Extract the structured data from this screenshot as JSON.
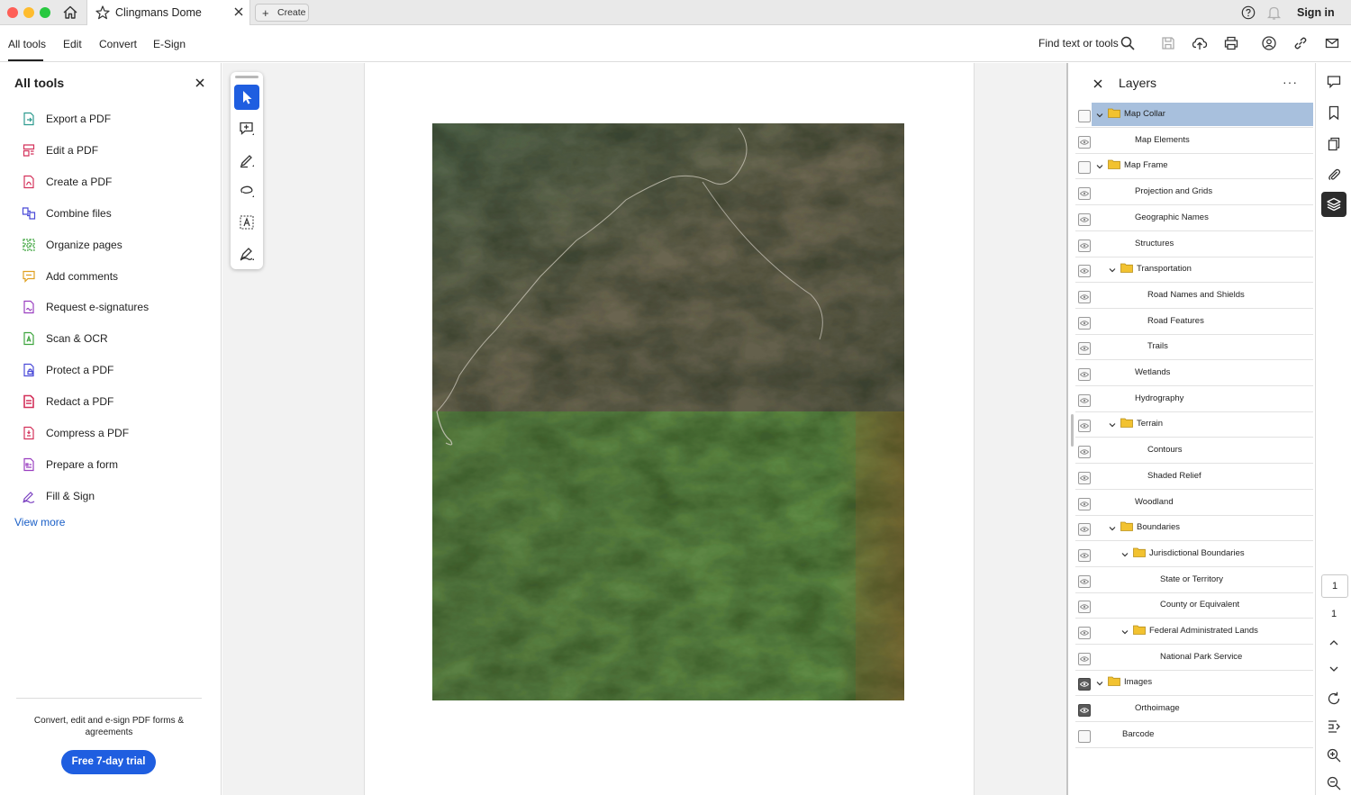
{
  "titlebar": {
    "tab_title": "Clingmans Dome",
    "create_label": "Create",
    "signin_label": "Sign in"
  },
  "menubar": {
    "items": [
      "All tools",
      "Edit",
      "Convert",
      "E-Sign"
    ],
    "find_label": "Find text or tools"
  },
  "all_tools": {
    "title": "All tools",
    "items": [
      {
        "label": "Export a PDF",
        "icon": "export-pdf-icon",
        "color": "#2e9b8f"
      },
      {
        "label": "Edit a PDF",
        "icon": "edit-pdf-icon",
        "color": "#d4325b"
      },
      {
        "label": "Create a PDF",
        "icon": "create-pdf-icon",
        "color": "#d4325b"
      },
      {
        "label": "Combine files",
        "icon": "combine-files-icon",
        "color": "#4a4ad8"
      },
      {
        "label": "Organize pages",
        "icon": "organize-pages-icon",
        "color": "#3ea53e"
      },
      {
        "label": "Add comments",
        "icon": "add-comments-icon",
        "color": "#e0a020"
      },
      {
        "label": "Request e-signatures",
        "icon": "request-signatures-icon",
        "color": "#9a3fc0"
      },
      {
        "label": "Scan & OCR",
        "icon": "scan-ocr-icon",
        "color": "#3ea53e"
      },
      {
        "label": "Protect a PDF",
        "icon": "protect-pdf-icon",
        "color": "#4a4ad8"
      },
      {
        "label": "Redact a PDF",
        "icon": "redact-pdf-icon",
        "color": "#d4325b"
      },
      {
        "label": "Compress a PDF",
        "icon": "compress-pdf-icon",
        "color": "#d4325b"
      },
      {
        "label": "Prepare a form",
        "icon": "prepare-form-icon",
        "color": "#9a3fc0"
      },
      {
        "label": "Fill & Sign",
        "icon": "fill-sign-icon",
        "color": "#7a3fc0"
      }
    ],
    "view_more": "View more",
    "promo_text": "Convert, edit and e-sign PDF forms & agreements",
    "trial_button": "Free 7-day trial"
  },
  "layers": {
    "title": "Layers",
    "more": "···",
    "rows": [
      {
        "label": "Map Collar",
        "indent": 0,
        "folder": true,
        "eye": "off",
        "selected": true
      },
      {
        "label": "Map Elements",
        "indent": 1,
        "folder": false,
        "eye": "eye"
      },
      {
        "label": "Map Frame",
        "indent": 0,
        "folder": true,
        "eye": "off"
      },
      {
        "label": "Projection and Grids",
        "indent": 1,
        "folder": false,
        "eye": "eye"
      },
      {
        "label": "Geographic Names",
        "indent": 1,
        "folder": false,
        "eye": "eye"
      },
      {
        "label": "Structures",
        "indent": 1,
        "folder": false,
        "eye": "eye"
      },
      {
        "label": "Transportation",
        "indent": 1,
        "folder": true,
        "eye": "eye"
      },
      {
        "label": "Road Names and Shields",
        "indent": 2,
        "folder": false,
        "eye": "eye"
      },
      {
        "label": "Road Features",
        "indent": 2,
        "folder": false,
        "eye": "eye"
      },
      {
        "label": "Trails",
        "indent": 2,
        "folder": false,
        "eye": "eye"
      },
      {
        "label": "Wetlands",
        "indent": 1,
        "folder": false,
        "eye": "eye"
      },
      {
        "label": "Hydrography",
        "indent": 1,
        "folder": false,
        "eye": "eye"
      },
      {
        "label": "Terrain",
        "indent": 1,
        "folder": true,
        "eye": "eye"
      },
      {
        "label": "Contours",
        "indent": 2,
        "folder": false,
        "eye": "eye"
      },
      {
        "label": "Shaded Relief",
        "indent": 2,
        "folder": false,
        "eye": "eye"
      },
      {
        "label": "Woodland",
        "indent": 1,
        "folder": false,
        "eye": "eye"
      },
      {
        "label": "Boundaries",
        "indent": 1,
        "folder": true,
        "eye": "eye"
      },
      {
        "label": "Jurisdictional Boundaries",
        "indent": 2,
        "folder": true,
        "eye": "eye"
      },
      {
        "label": "State or Territory",
        "indent": 3,
        "folder": false,
        "eye": "eye"
      },
      {
        "label": "County or Equivalent",
        "indent": 3,
        "folder": false,
        "eye": "eye"
      },
      {
        "label": "Federal Administrated Lands",
        "indent": 2,
        "folder": true,
        "eye": "eye"
      },
      {
        "label": "National Park Service",
        "indent": 3,
        "folder": false,
        "eye": "eye"
      },
      {
        "label": "Images",
        "indent": 0,
        "folder": true,
        "eye": "on"
      },
      {
        "label": "Orthoimage",
        "indent": 1,
        "folder": false,
        "eye": "on"
      },
      {
        "label": "Barcode",
        "indent": 0,
        "folder": false,
        "eye": "off"
      }
    ]
  },
  "pager": {
    "current_page": "1",
    "total_pages": "1"
  },
  "colors": {
    "accent": "#1f5ee0",
    "selected_layer": "#a8c0dd",
    "folder": "#f2c230"
  }
}
